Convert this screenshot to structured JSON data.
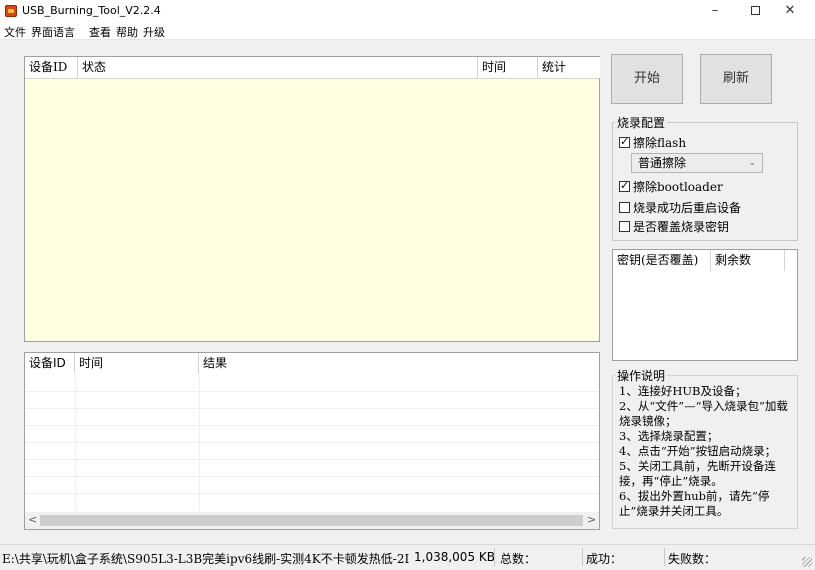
{
  "window": {
    "title": "USB_Burning_Tool_V2.2.4",
    "minimize": "–",
    "close": "✕"
  },
  "menu": [
    "文件",
    "界面语言",
    "查看",
    "帮助",
    "升级"
  ],
  "device_table": {
    "columns": [
      "设备ID",
      "状态",
      "时间",
      "统计"
    ]
  },
  "result_table": {
    "columns": [
      "设备ID",
      "时间",
      "结果"
    ],
    "scroll_left": "<",
    "scroll_right": ">"
  },
  "buttons": {
    "start": "开始",
    "refresh": "刷新"
  },
  "burn_config": {
    "title": "烧录配置",
    "erase_flash": {
      "label": "擦除flash",
      "checked": true
    },
    "erase_mode": "普通擦除",
    "erase_mode_chevron": "⌄",
    "erase_bootloader": {
      "label": "擦除bootloader",
      "checked": true
    },
    "reboot_after": {
      "label": "烧录成功后重启设备",
      "checked": false
    },
    "overwrite_key": {
      "label": "是否覆盖烧录密钥",
      "checked": false
    }
  },
  "key_table": {
    "columns": [
      "密钥(是否覆盖)",
      "剩余数"
    ]
  },
  "instructions": {
    "title": "操作说明",
    "lines": [
      "1、连接好HUB及设备；",
      "2、从“文件”—“导入烧录包”加载烧录镜像；",
      "3、选择烧录配置；",
      "4、点击“开始”按钮启动烧录；",
      "5、关闭工具前，先断开设备连接，再“停止”烧录。",
      "6、拔出外置hub前，请先“停止”烧录并关闭工具。"
    ]
  },
  "status_bar": {
    "file_path": "E:\\共享\\玩机\\盒子系统\\S905L3-L3B完美ipv6线刷-实测4K不卡顿发热低-2I",
    "file_size": "1,038,005 KB",
    "total": "总数：",
    "success": "成功：",
    "fail": "失败数："
  }
}
